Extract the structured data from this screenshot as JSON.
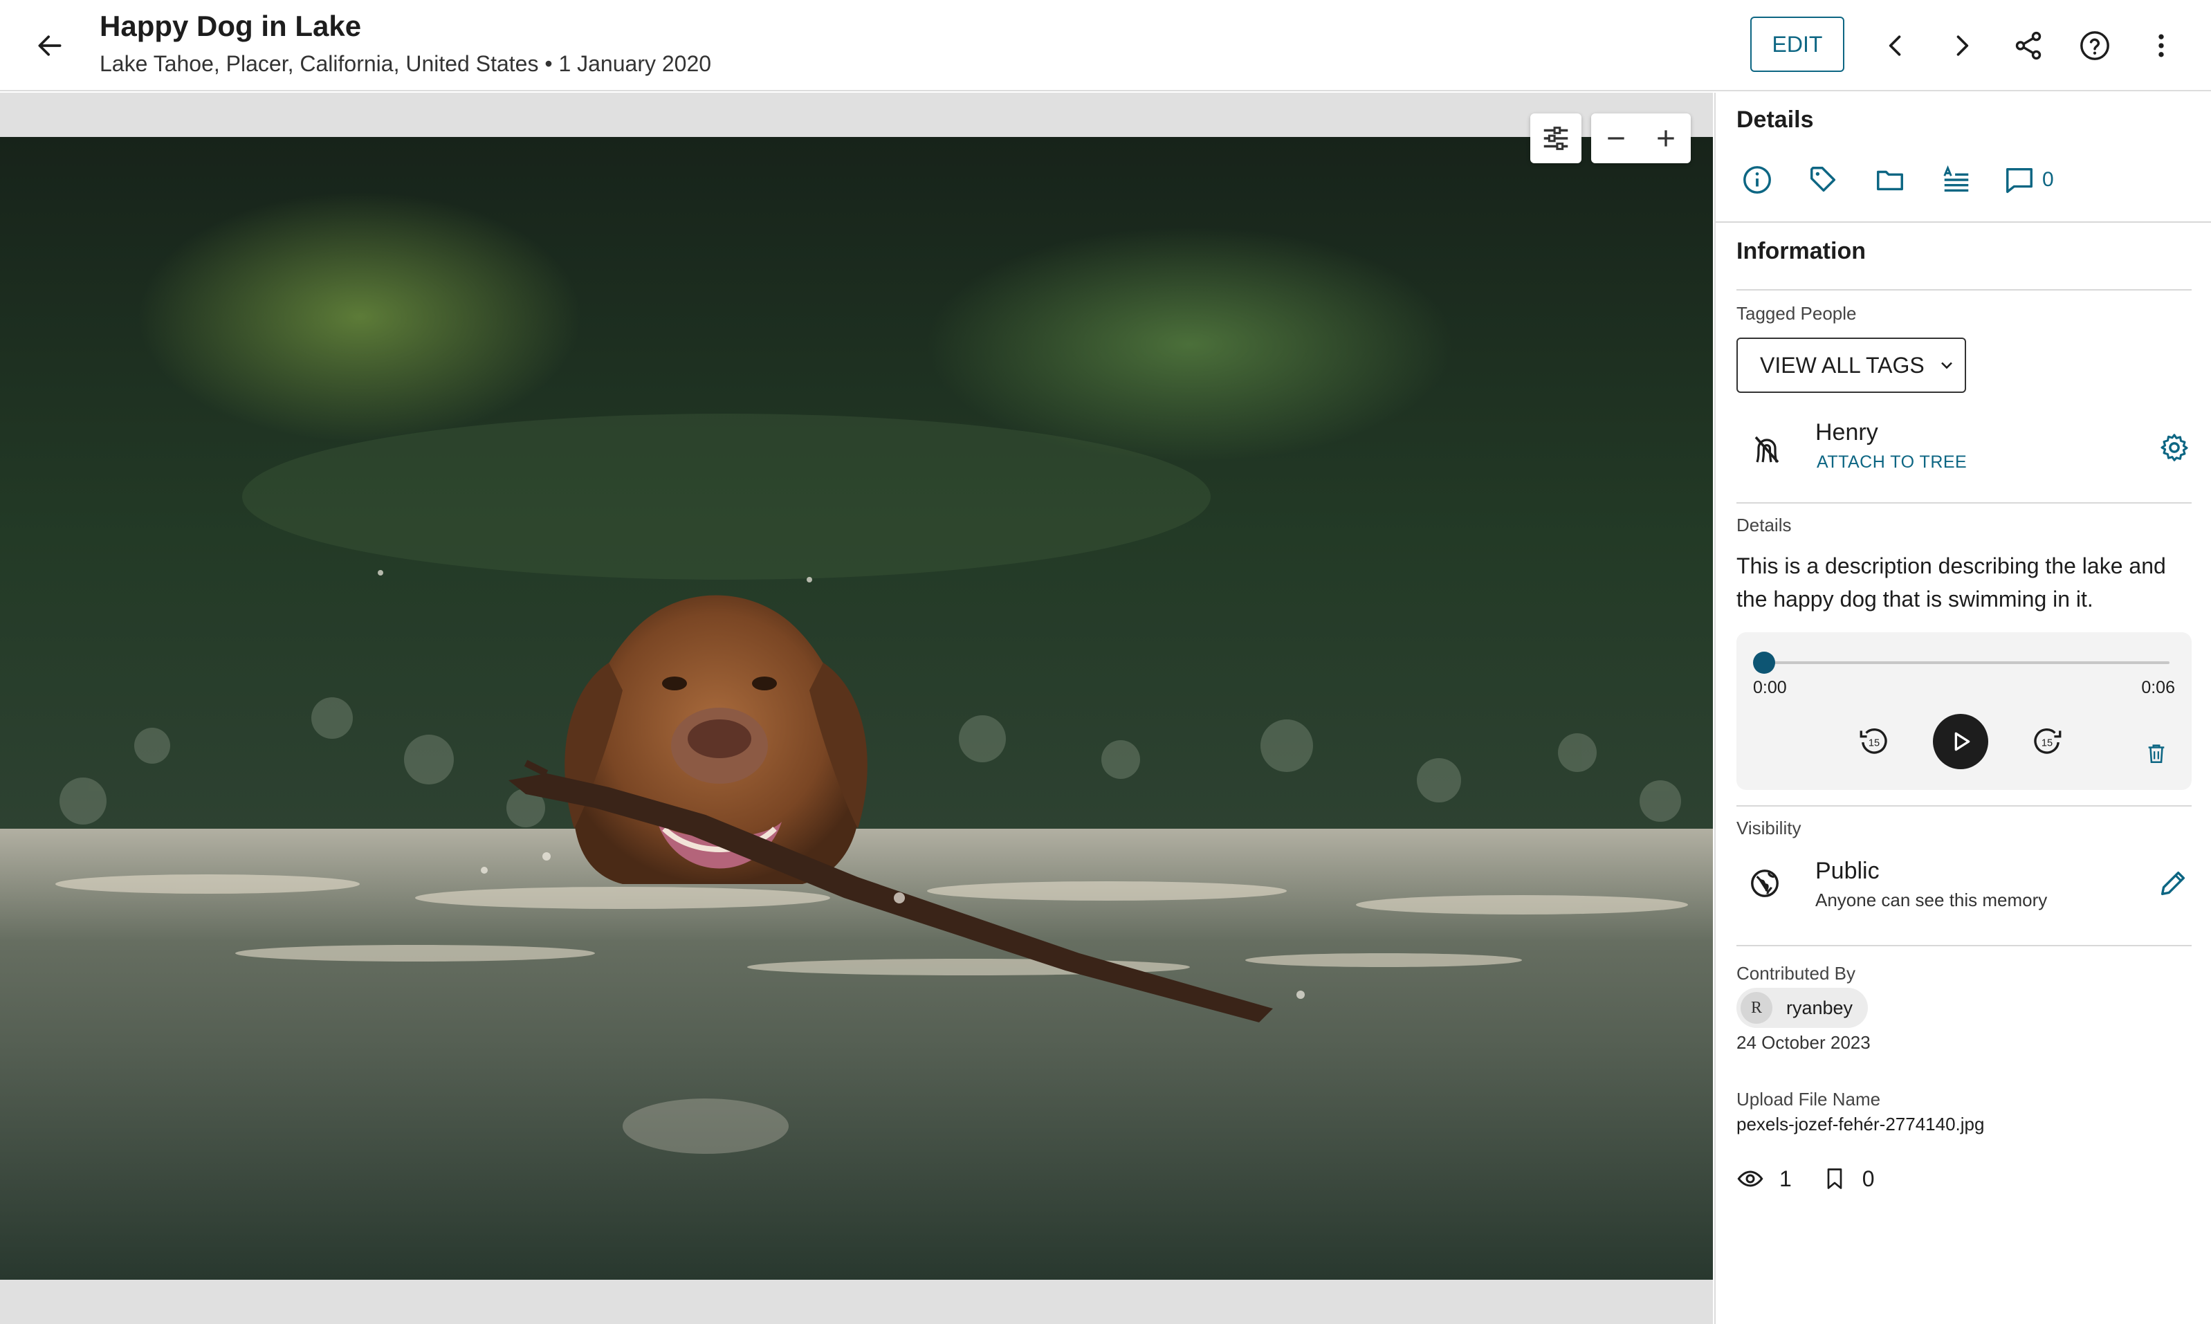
{
  "header": {
    "title": "Happy Dog in Lake",
    "subtitle": "Lake Tahoe, Placer, California, United States • 1 January 2020",
    "edit_label": "EDIT",
    "icons": [
      "back-arrow-icon",
      "chevron-left-icon",
      "chevron-right-icon",
      "share-icon",
      "help-icon",
      "more-vert-icon"
    ]
  },
  "viewer": {
    "tools": [
      "adjust-sliders-icon",
      "zoom-out-icon",
      "zoom-in-icon"
    ]
  },
  "panel": {
    "heading": "Details",
    "tabs": [
      "info-icon",
      "tag-icon",
      "folder-icon",
      "text-lines-icon",
      "comment-icon"
    ],
    "comment_count": "0",
    "information_heading": "Information",
    "tagged_people_label": "Tagged People",
    "view_all_tags_label": "VIEW ALL TAGS",
    "person": {
      "name": "Henry",
      "action": "ATTACH TO TREE"
    },
    "details_label": "Details",
    "description": "This is a description describing the lake and the happy dog that is swimming in it.",
    "audio": {
      "current": "0:00",
      "duration": "0:06",
      "progress": 0
    },
    "visibility_label": "Visibility",
    "visibility": {
      "title": "Public",
      "description": "Anyone can see this memory"
    },
    "contributed_by_label": "Contributed By",
    "contributor": {
      "initial": "R",
      "name": "ryanbey"
    },
    "contributed_date": "24 October 2023",
    "upload_file_label": "Upload File Name",
    "upload_file_name": "pexels-jozef-fehér-2774140.jpg",
    "stats": {
      "views": "1",
      "bookmarks": "0"
    }
  },
  "colors": {
    "accent": "#0d6683",
    "play_button": "#1d1d1d"
  }
}
